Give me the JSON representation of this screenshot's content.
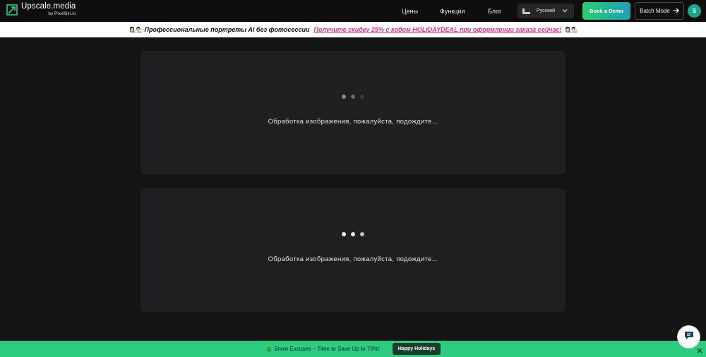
{
  "header": {
    "logo_title": "Upscale.media",
    "logo_sub": "by PixelBin.io",
    "nav": {
      "prices": "Цены",
      "features": "Функции",
      "blog": "Блог"
    },
    "language": {
      "selected": "Русский",
      "icon": "flag-icon"
    },
    "book_demo": "Book a Demo",
    "batch_mode": "Batch Mode",
    "avatar_initial": "S"
  },
  "promo": {
    "emoji": "👩🏻‍🎨👨🏻‍🎨",
    "text": "Профессиональные портреты AI без фотосессии",
    "link": "Получите скидку 25% с кодом HOLIDAYDEAL при оформлении заказа сейчас!",
    "emoji_end": "👩🏻‍🎨👨🏻‍🎨"
  },
  "panels": [
    {
      "status": "Обработка изображения, пожалуйста, подождите..."
    },
    {
      "status": "Обработка изображения, пожалуйста, подождите..."
    }
  ],
  "bottom_banner": {
    "text": "🎄 Snow Excuses – Time to Save Up to 70%!",
    "button": "Happy Holidays"
  },
  "colors": {
    "accent_green": "#2ecc80",
    "promo_link": "#d63384",
    "avatar_bg": "#17a58e"
  }
}
